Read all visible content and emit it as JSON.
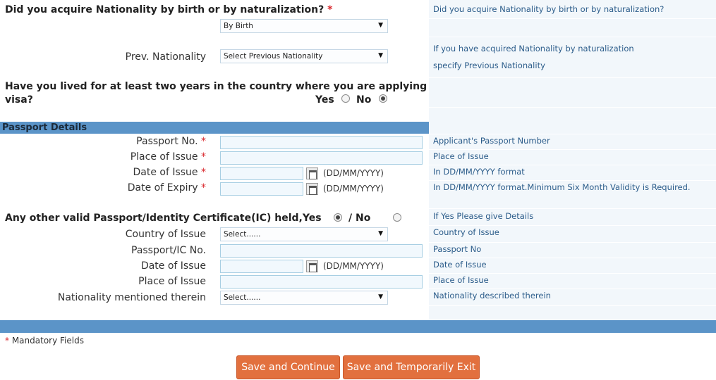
{
  "questions": {
    "nationality_by": "Did you acquire Nationality by birth or by naturalization?",
    "lived_two_years_line1": "Have you lived for at least two years in the country where you are applying",
    "lived_two_years_line2": "visa?",
    "other_passport": "Any other valid Passport/Identity Certificate(IC) held,Yes"
  },
  "required_marker": "*",
  "nationality_select": {
    "value": "By Birth"
  },
  "prev_nationality": {
    "label": "Prev. Nationality",
    "value": "Select Previous Nationality"
  },
  "lived_radio": {
    "yes_label": "Yes",
    "no_label": "No",
    "selected": "No"
  },
  "passport_section": {
    "title": "Passport Details",
    "passport_no_label": "Passport No.",
    "place_of_issue_label": "Place of Issue",
    "date_of_issue_label": "Date of Issue",
    "date_of_expiry_label": "Date of Expiry",
    "date_format": "(DD/MM/YYYY)"
  },
  "other_passport_radio": {
    "slash_no_label": "/ No",
    "selected": "Yes"
  },
  "other_section": {
    "country_label": "Country of Issue",
    "country_value": "Select......",
    "passport_ic_label": "Passport/IC No.",
    "date_of_issue_label": "Date of Issue",
    "date_format": "(DD/MM/YYYY)",
    "place_of_issue_label": "Place of Issue",
    "nationality_label": "Nationality mentioned therein",
    "nationality_value": "Select......"
  },
  "help": {
    "h1": "Did you acquire Nationality by birth or by naturalization?",
    "h2": "If you have acquired Nationality by naturalization",
    "h3": "specify Previous Nationality",
    "h4": "Applicant's Passport Number",
    "h5": "Place of Issue",
    "h6": "In DD/MM/YYYY format",
    "h7": "In DD/MM/YYYY format.Minimum Six Month Validity is Required.",
    "h8": "If Yes Please give Details",
    "h9": "Country of Issue",
    "h10": "Passport No",
    "h11": "Date of Issue",
    "h12": "Place of Issue",
    "h13": "Nationality described therein"
  },
  "footer": {
    "mandatory_label": "Mandatory Fields",
    "save_continue": "Save and Continue",
    "save_exit": "Save and Temporarily Exit"
  },
  "colors": {
    "accent": "#5b94c8",
    "button": "#e2703e",
    "help_text": "#2b5c8a",
    "required": "#d9262b"
  },
  "icons": [
    "dropdown-arrow-icon",
    "calendar-icon",
    "radio-icon"
  ]
}
